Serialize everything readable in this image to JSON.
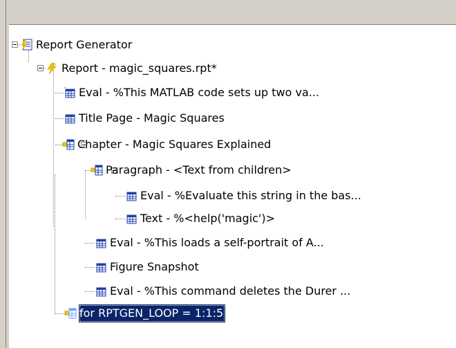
{
  "tree": {
    "nodes": [
      {
        "label": "Report Generator",
        "icon": "report-generator-icon"
      },
      {
        "label": "Report - magic_squares.rpt*",
        "icon": "report-lightning-icon"
      },
      {
        "label": "Eval - %This MATLAB code sets up two va...",
        "icon": "table-component-icon"
      },
      {
        "label": "Title Page - Magic Squares",
        "icon": "table-component-icon"
      },
      {
        "label": "Chapter - Magic Squares Explained",
        "icon": "chapter-component-icon"
      },
      {
        "label": "Paragraph - <Text from children>",
        "icon": "paragraph-component-icon"
      },
      {
        "label": "Eval - %Evaluate this string in the bas...",
        "icon": "table-component-icon"
      },
      {
        "label": "Text - %<help('magic')>",
        "icon": "table-component-icon"
      },
      {
        "label": "Eval - %This loads a self-portrait of A...",
        "icon": "table-component-icon"
      },
      {
        "label": "Figure Snapshot",
        "icon": "table-component-icon"
      },
      {
        "label": "Eval - %This command deletes the Durer ...",
        "icon": "table-component-icon"
      },
      {
        "label": "for RPTGEN_LOOP = 1:1:5",
        "icon": "loop-component-icon",
        "selected": true
      }
    ]
  },
  "colors": {
    "selection": "#0a246a",
    "chrome": "#d4d0c8",
    "icon_blue": "#1f3fa8",
    "icon_gold": "#c99a00"
  }
}
